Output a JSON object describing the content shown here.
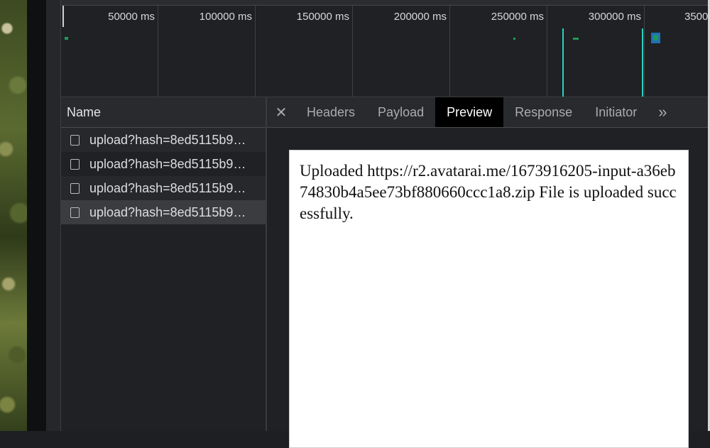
{
  "timeline": {
    "ticks": [
      "50000 ms",
      "100000 ms",
      "150000 ms",
      "200000 ms",
      "250000 ms",
      "300000 ms",
      "3500"
    ]
  },
  "requests": {
    "header": "Name",
    "rows": [
      "upload?hash=8ed5115b9…",
      "upload?hash=8ed5115b9…",
      "upload?hash=8ed5115b9…",
      "upload?hash=8ed5115b9…"
    ]
  },
  "tabs": {
    "close": "✕",
    "items": [
      "Headers",
      "Payload",
      "Preview",
      "Response",
      "Initiator"
    ],
    "more": "»"
  },
  "preview": {
    "text": "Uploaded https://r2.avatarai.me/1673916205-input-a36eb74830b4a5ee73bf880660ccc1a8.zip File is uploaded successfully."
  },
  "colors": {
    "active_tab_bg": "#000000",
    "selected_row_bg": "#3b3c3f",
    "marker_cyan": "#2ad1c4",
    "bar_green": "#1e9a5b",
    "bar_blue": "#1f6fb8"
  }
}
